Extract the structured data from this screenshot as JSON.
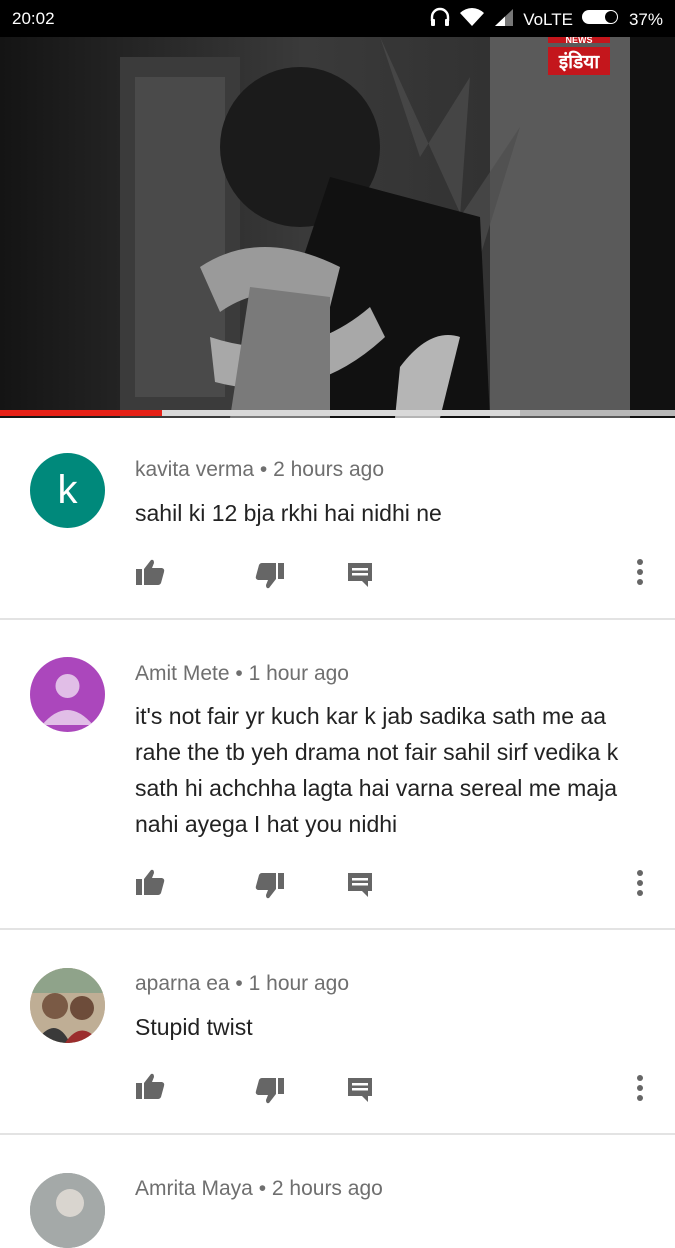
{
  "status_bar": {
    "time": "20:02",
    "network": "VoLTE",
    "battery": "37%"
  },
  "video": {
    "watermark": "इंडिया",
    "watermark_top": "NEWS",
    "progress_fraction": 0.24
  },
  "comments": [
    {
      "author": "kavita verma",
      "time": "2 hours ago",
      "text": "sahil ki 12 bja rkhi hai nidhi ne",
      "avatar_letter": "k",
      "avatar_color": "#00897b"
    },
    {
      "author": "Amit Mete",
      "time": "1 hour ago",
      "text": "it's not fair yr kuch kar k  jab sadika sath me aa rahe the tb yeh drama not fair sahil sirf vedika k sath hi achchha lagta hai varna sereal me maja nahi ayega I hat you nidhi",
      "avatar_color": "#ab47bc"
    },
    {
      "author": "aparna ea",
      "time": "1 hour ago",
      "text": "Stupid twist"
    },
    {
      "author": "Amrita Maya",
      "time": "2 hours ago"
    }
  ],
  "separator": " • ",
  "icons": {
    "like": "thumbs-up-icon",
    "dislike": "thumbs-down-icon",
    "reply": "reply-icon",
    "more": "more-vert-icon"
  }
}
